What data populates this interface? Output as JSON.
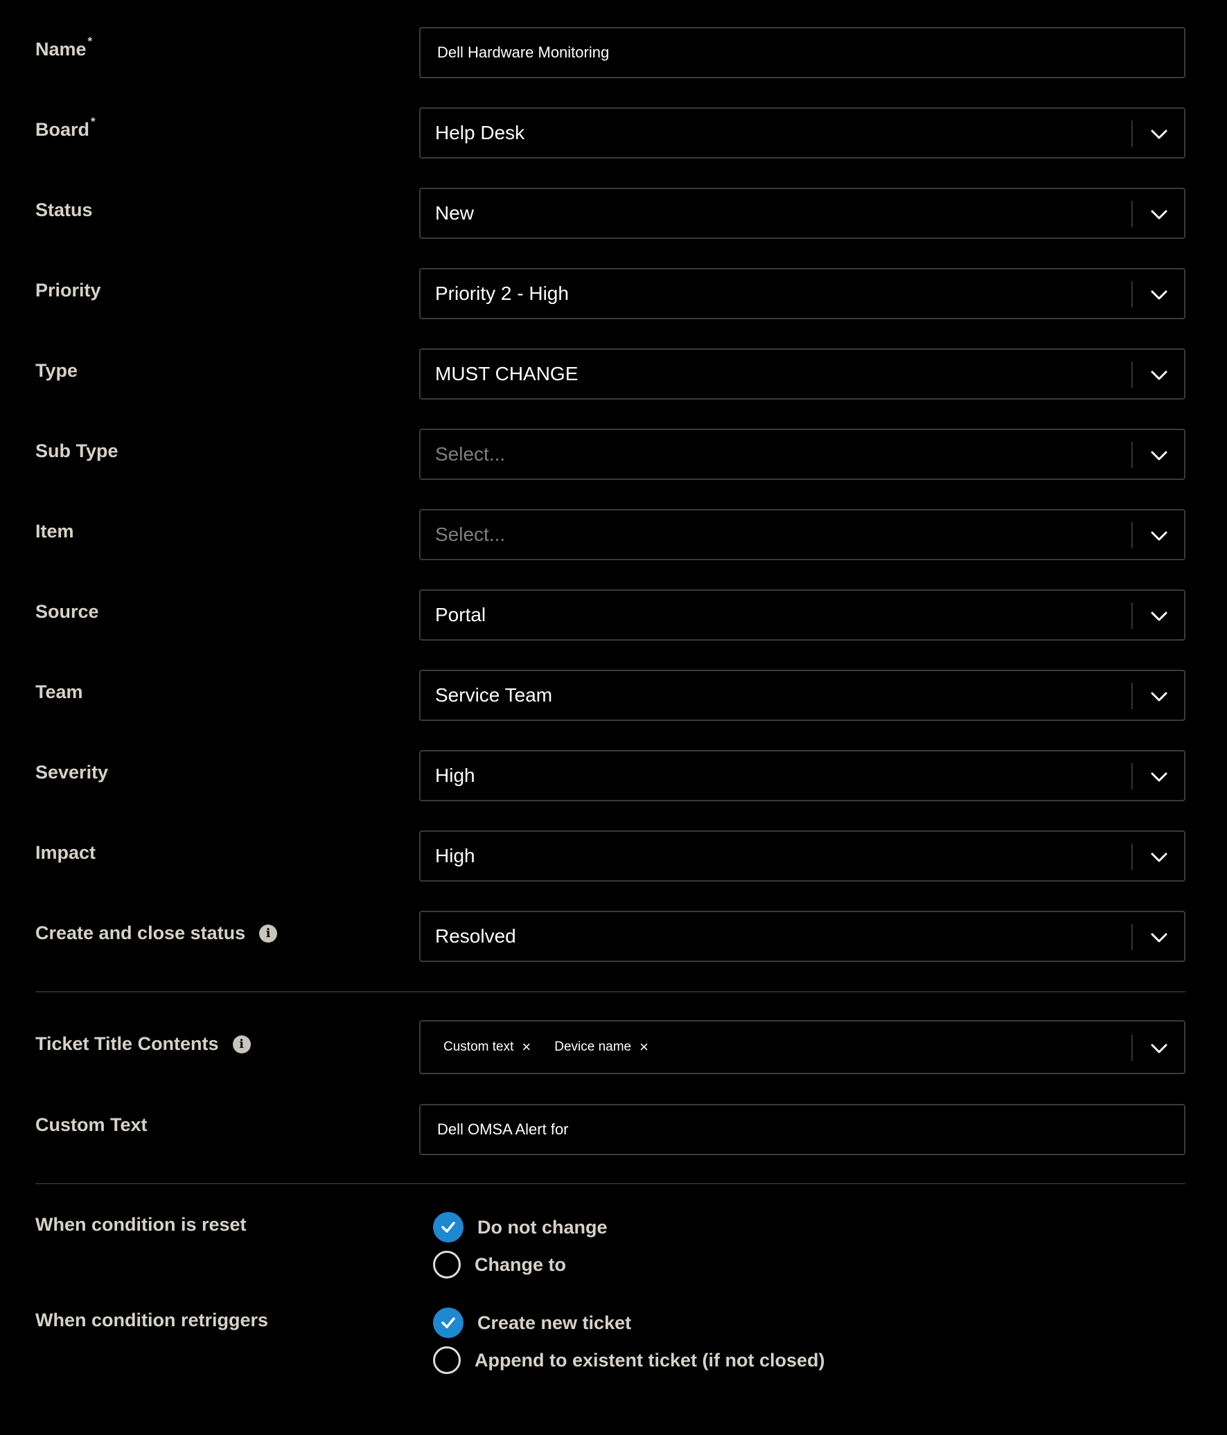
{
  "fields": {
    "name": {
      "label": "Name",
      "required_mark": "*",
      "value": "Dell Hardware Monitoring"
    },
    "board": {
      "label": "Board",
      "required_mark": "*",
      "value": "Help Desk"
    },
    "status": {
      "label": "Status",
      "value": "New"
    },
    "priority": {
      "label": "Priority",
      "value": "Priority 2 - High"
    },
    "type": {
      "label": "Type",
      "value": "MUST CHANGE"
    },
    "sub_type": {
      "label": "Sub Type",
      "placeholder": "Select..."
    },
    "item": {
      "label": "Item",
      "placeholder": "Select..."
    },
    "source": {
      "label": "Source",
      "value": "Portal"
    },
    "team": {
      "label": "Team",
      "value": "Service Team"
    },
    "severity": {
      "label": "Severity",
      "value": "High"
    },
    "impact": {
      "label": "Impact",
      "value": "High"
    },
    "create_close_status": {
      "label": "Create and close status",
      "value": "Resolved"
    },
    "ticket_title_contents": {
      "label": "Ticket Title Contents",
      "tags": [
        "Custom text",
        "Device name"
      ],
      "remove_glyph": "×"
    },
    "custom_text": {
      "label": "Custom Text",
      "value": "Dell OMSA Alert for"
    }
  },
  "condition_reset": {
    "label": "When condition is reset",
    "options": [
      {
        "label": "Do not change",
        "selected": true
      },
      {
        "label": "Change to",
        "selected": false
      }
    ]
  },
  "condition_retriggers": {
    "label": "When condition retriggers",
    "options": [
      {
        "label": "Create new ticket",
        "selected": true
      },
      {
        "label": "Append to existent ticket (if not closed)",
        "selected": false
      }
    ]
  },
  "icons": {
    "dropdown": "chevron-down-icon",
    "info": "info-icon",
    "radio_checked": "checkmark-icon",
    "tag_remove": "close-icon"
  },
  "colors": {
    "background": "#000000",
    "label": "#d6d2c8",
    "field_border": "#3a3a3a",
    "placeholder": "#7f7f7f",
    "accent": "#1e88d1"
  },
  "info_glyph": "i"
}
